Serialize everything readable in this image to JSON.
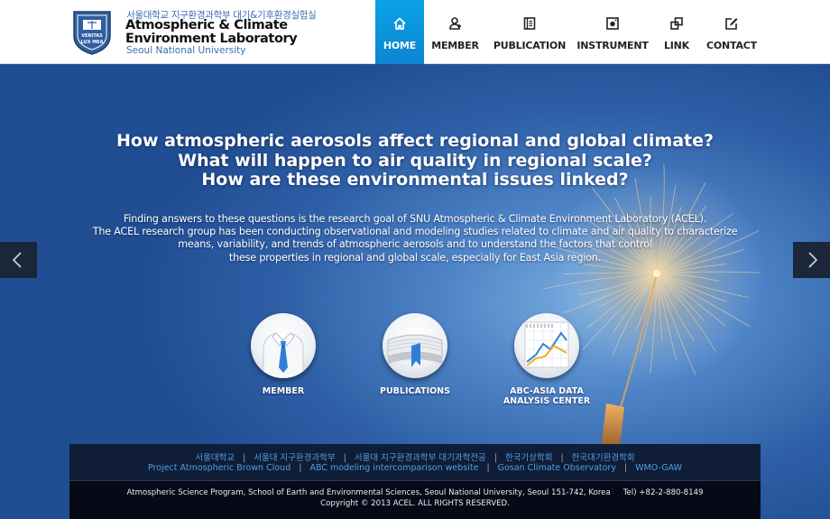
{
  "brand": {
    "korean_name": "서울대학교 지구환경과학부 대기&기후환경실험실",
    "english_name": "Atmospheric & Climate Environment Laboratory",
    "university": "Seoul National University",
    "logo_text": "VERITAS LUX MEA"
  },
  "nav": {
    "items": [
      {
        "label": "HOME",
        "icon": "home-icon",
        "active": true
      },
      {
        "label": "MEMBER",
        "icon": "member-icon",
        "active": false
      },
      {
        "label": "PUBLICATION",
        "icon": "book-icon",
        "active": false
      },
      {
        "label": "INSTRUMENT",
        "icon": "camera-icon",
        "active": false
      },
      {
        "label": "LINK",
        "icon": "link-icon",
        "active": false
      },
      {
        "label": "CONTACT",
        "icon": "pencil-icon",
        "active": false
      }
    ],
    "active_color": "#0c95dc"
  },
  "hero": {
    "headline": [
      "How atmospheric aerosols affect regional and global climate?",
      "What will happen to air quality in regional scale?",
      "How are these environmental issues linked?"
    ],
    "intro": [
      "Finding answers to these questions is the research goal of SNU Atmospheric & Climate Environment Laboratory (ACEL).",
      "The ACEL research group has been conducting observational and modeling studies related to climate and air quality to characterize",
      "means, variability, and trends of atmospheric aerosols and to understand the factors that control",
      "these properties in regional and global scale, especially for East Asia region."
    ],
    "prev_icon": "chevron-left-icon",
    "next_icon": "chevron-right-icon"
  },
  "features": [
    {
      "label_lines": [
        "MEMBER"
      ],
      "icon": "shirt-tie-icon"
    },
    {
      "label_lines": [
        "PUBLICATIONS"
      ],
      "icon": "book-bookmark-icon"
    },
    {
      "label_lines": [
        "ABC-ASIA DATA",
        "ANALYSIS CENTER"
      ],
      "icon": "line-chart-icon"
    }
  ],
  "footer": {
    "links_row1": [
      "서울대학교",
      "서울대 지구환경과학부",
      "서울대 지구환경과학부 대기과학전공",
      "한국기상학회",
      "한국대기환경학회"
    ],
    "links_row2": [
      "Project Atmospheric Brown Cloud",
      "ABC modeling intercomparison website",
      "Gosan Climate Observatory",
      "WMO-GAW"
    ],
    "separator": "|",
    "address": "Atmospheric Science Program, School of Earth and Environmental Sciences, Seoul National University, Seoul 151-742, Korea",
    "tel": "Tel) +82-2-880-8149",
    "copyright": "Copyright © 2013 ACEL. ALL RIGHTS RESERVED."
  }
}
